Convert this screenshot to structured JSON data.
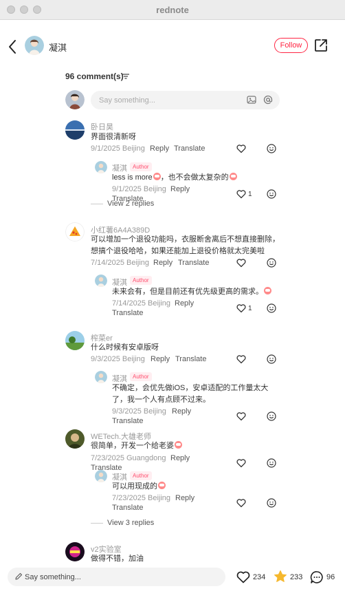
{
  "window": {
    "title": "rednote"
  },
  "header": {
    "author_name": "凝淇",
    "follow_label": "Follow"
  },
  "comments_header": {
    "count_label": "96 comment(s)"
  },
  "composer": {
    "placeholder": "Say something..."
  },
  "comments": [
    {
      "name": "卧日昊",
      "text": "界面很清新呀",
      "date_location": "9/1/2025 Beijing",
      "reply_label": "Reply",
      "translate_label": "Translate",
      "replies": [
        {
          "name": "凝淇",
          "badge": "Author",
          "text_line1": "less is more",
          "text_line2": "，也不会做太复杂的",
          "date_location": "9/1/2025 Beijing",
          "reply_label": "Reply",
          "translate_label": "Translate",
          "likes": "1"
        }
      ],
      "view_replies": "View 2 replies"
    },
    {
      "name": "小红薯6A4A389D",
      "text_line1": "可以增加一个退役功能吗，衣服断舍离后不想直接删除，",
      "text_line2": "想搞个退役哈哈，如果还能加上退役价格就太完美啦",
      "date_location": "7/14/2025 Beijing",
      "reply_label": "Reply",
      "translate_label": "Translate",
      "replies": [
        {
          "name": "凝淇",
          "badge": "Author",
          "text": "未来会有，但是目前还有优先级更高的需求。",
          "date_location": "7/14/2025 Beijing",
          "reply_label": "Reply",
          "translate_label": "Translate",
          "likes": "1"
        }
      ]
    },
    {
      "name": "榨菜er",
      "text": "什么时候有安卓版呀",
      "date_location": "9/3/2025 Beijing",
      "reply_label": "Reply",
      "translate_label": "Translate",
      "replies": [
        {
          "name": "凝淇",
          "badge": "Author",
          "text_line1": "不确定，会优先做iOS，安卓适配的工作量太大",
          "text_line2": "了，我一个人有点顾不过来。",
          "date_location": "9/3/2025 Beijing",
          "reply_label": "Reply",
          "translate_label": "Translate"
        }
      ]
    },
    {
      "name": "WETech.大雄老师",
      "text": "很简单，开发一个给老婆",
      "date_location": "7/23/2025 Guangdong",
      "reply_label": "Reply",
      "translate_label": "Translate",
      "replies": [
        {
          "name": "凝淇",
          "badge": "Author",
          "text": "可以用现成的",
          "date_location": "7/23/2025 Beijing",
          "reply_label": "Reply",
          "translate_label": "Translate"
        }
      ],
      "view_replies": "View 3 replies"
    },
    {
      "name": "v2实验室",
      "text": "做得不错，加油"
    }
  ],
  "bottom_bar": {
    "placeholder": "Say something...",
    "likes": "234",
    "collects": "233",
    "comments": "96"
  },
  "colors": {
    "accent": "#ff2442",
    "star": "#f5b82e"
  }
}
